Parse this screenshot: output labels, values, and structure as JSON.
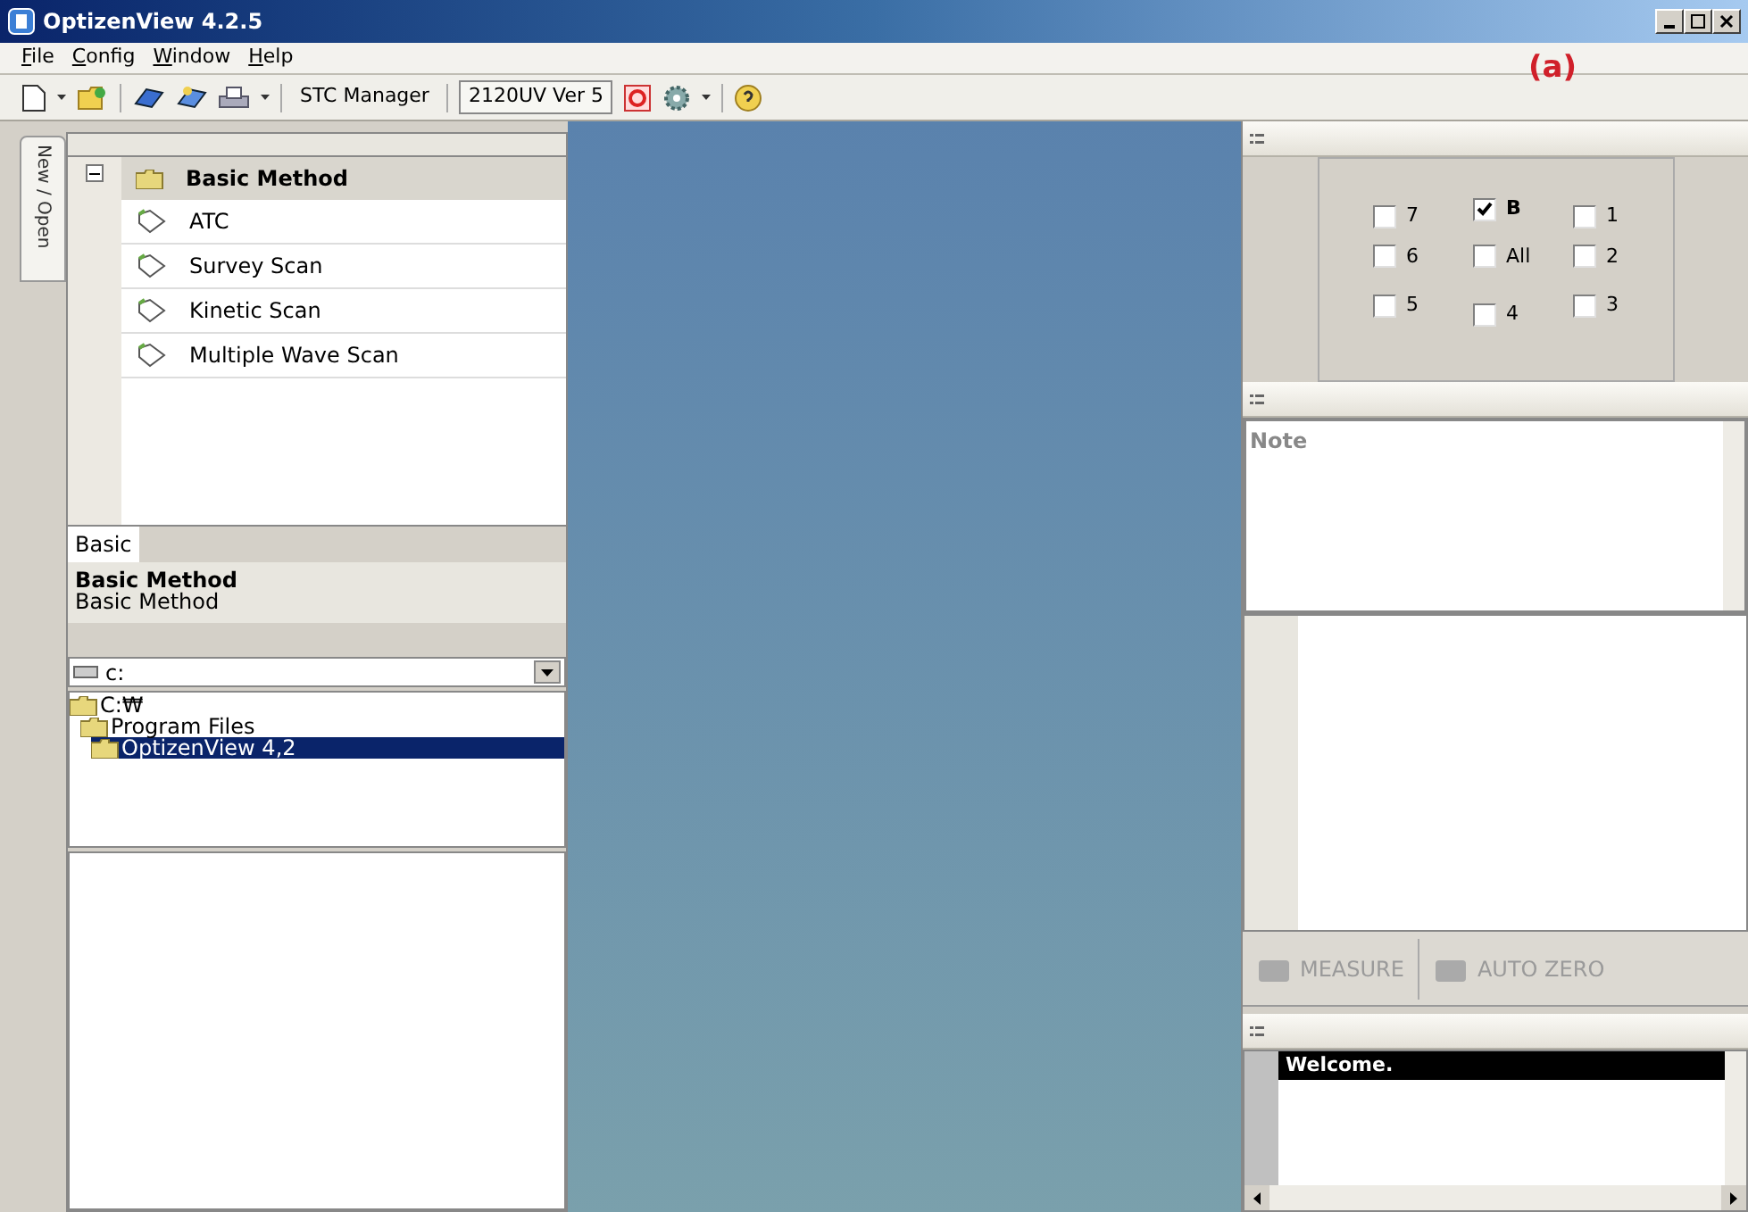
{
  "window": {
    "title": "OptizenView 4.2.5"
  },
  "menu": [
    "File",
    "Config",
    "Window",
    "Help"
  ],
  "toolbar": {
    "stc_button": "STC Manager",
    "instrument": "2120UV Ver 5"
  },
  "figure_label": "(a)",
  "side_tab": "New / Open",
  "method_tree": {
    "root": {
      "label": "Basic Method",
      "expanded": true,
      "selected": true
    },
    "children": [
      {
        "label": "ATC",
        "selected": false
      },
      {
        "label": "Survey Scan",
        "selected": false
      },
      {
        "label": "Kinetic Scan",
        "selected": false
      },
      {
        "label": "Multiple Wave Scan",
        "selected": false
      }
    ]
  },
  "method_tabs": [
    {
      "label": "Basic",
      "selected": true
    }
  ],
  "description": {
    "title": "Basic Method",
    "text": "Basic Method"
  },
  "drive": "c:",
  "folders": [
    {
      "label": "C:₩",
      "selected": false,
      "children": [
        {
          "label": "Program Files",
          "selected": false,
          "children": [
            {
              "label": "OptizenView 4,2",
              "selected": true
            }
          ]
        }
      ]
    }
  ],
  "cells": [
    {
      "label": "7",
      "checked": false
    },
    {
      "label": "B",
      "checked": true
    },
    {
      "label": "1",
      "checked": false
    },
    {
      "label": "6",
      "checked": false
    },
    {
      "label": "All",
      "checked": false
    },
    {
      "label": "2",
      "checked": false
    },
    {
      "label": "5",
      "checked": false
    },
    {
      "label": "4",
      "checked": false
    },
    {
      "label": "3",
      "checked": false
    }
  ],
  "note": {
    "placeholder": "Note"
  },
  "actions": [
    {
      "label": "MEASURE",
      "disabled": true
    },
    {
      "label": "AUTO ZERO",
      "disabled": true
    }
  ],
  "log": [
    "Welcome."
  ]
}
